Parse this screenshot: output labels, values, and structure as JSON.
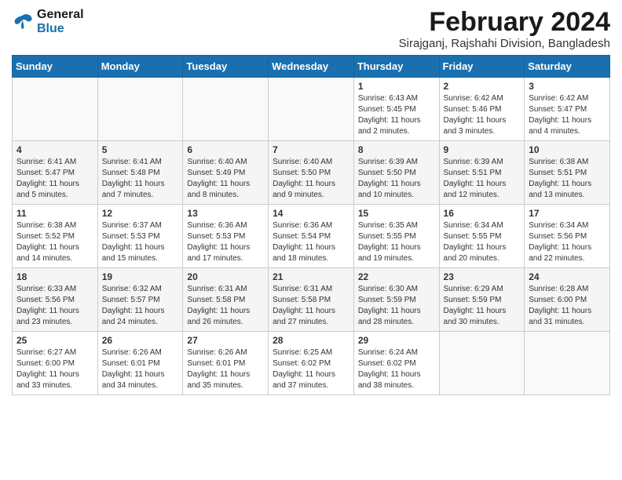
{
  "header": {
    "logo_line1": "General",
    "logo_line2": "Blue",
    "month_year": "February 2024",
    "location": "Sirajganj, Rajshahi Division, Bangladesh"
  },
  "days_of_week": [
    "Sunday",
    "Monday",
    "Tuesday",
    "Wednesday",
    "Thursday",
    "Friday",
    "Saturday"
  ],
  "weeks": [
    [
      {
        "day": "",
        "info": ""
      },
      {
        "day": "",
        "info": ""
      },
      {
        "day": "",
        "info": ""
      },
      {
        "day": "",
        "info": ""
      },
      {
        "day": "1",
        "info": "Sunrise: 6:43 AM\nSunset: 5:45 PM\nDaylight: 11 hours\nand 2 minutes."
      },
      {
        "day": "2",
        "info": "Sunrise: 6:42 AM\nSunset: 5:46 PM\nDaylight: 11 hours\nand 3 minutes."
      },
      {
        "day": "3",
        "info": "Sunrise: 6:42 AM\nSunset: 5:47 PM\nDaylight: 11 hours\nand 4 minutes."
      }
    ],
    [
      {
        "day": "4",
        "info": "Sunrise: 6:41 AM\nSunset: 5:47 PM\nDaylight: 11 hours\nand 5 minutes."
      },
      {
        "day": "5",
        "info": "Sunrise: 6:41 AM\nSunset: 5:48 PM\nDaylight: 11 hours\nand 7 minutes."
      },
      {
        "day": "6",
        "info": "Sunrise: 6:40 AM\nSunset: 5:49 PM\nDaylight: 11 hours\nand 8 minutes."
      },
      {
        "day": "7",
        "info": "Sunrise: 6:40 AM\nSunset: 5:50 PM\nDaylight: 11 hours\nand 9 minutes."
      },
      {
        "day": "8",
        "info": "Sunrise: 6:39 AM\nSunset: 5:50 PM\nDaylight: 11 hours\nand 10 minutes."
      },
      {
        "day": "9",
        "info": "Sunrise: 6:39 AM\nSunset: 5:51 PM\nDaylight: 11 hours\nand 12 minutes."
      },
      {
        "day": "10",
        "info": "Sunrise: 6:38 AM\nSunset: 5:51 PM\nDaylight: 11 hours\nand 13 minutes."
      }
    ],
    [
      {
        "day": "11",
        "info": "Sunrise: 6:38 AM\nSunset: 5:52 PM\nDaylight: 11 hours\nand 14 minutes."
      },
      {
        "day": "12",
        "info": "Sunrise: 6:37 AM\nSunset: 5:53 PM\nDaylight: 11 hours\nand 15 minutes."
      },
      {
        "day": "13",
        "info": "Sunrise: 6:36 AM\nSunset: 5:53 PM\nDaylight: 11 hours\nand 17 minutes."
      },
      {
        "day": "14",
        "info": "Sunrise: 6:36 AM\nSunset: 5:54 PM\nDaylight: 11 hours\nand 18 minutes."
      },
      {
        "day": "15",
        "info": "Sunrise: 6:35 AM\nSunset: 5:55 PM\nDaylight: 11 hours\nand 19 minutes."
      },
      {
        "day": "16",
        "info": "Sunrise: 6:34 AM\nSunset: 5:55 PM\nDaylight: 11 hours\nand 20 minutes."
      },
      {
        "day": "17",
        "info": "Sunrise: 6:34 AM\nSunset: 5:56 PM\nDaylight: 11 hours\nand 22 minutes."
      }
    ],
    [
      {
        "day": "18",
        "info": "Sunrise: 6:33 AM\nSunset: 5:56 PM\nDaylight: 11 hours\nand 23 minutes."
      },
      {
        "day": "19",
        "info": "Sunrise: 6:32 AM\nSunset: 5:57 PM\nDaylight: 11 hours\nand 24 minutes."
      },
      {
        "day": "20",
        "info": "Sunrise: 6:31 AM\nSunset: 5:58 PM\nDaylight: 11 hours\nand 26 minutes."
      },
      {
        "day": "21",
        "info": "Sunrise: 6:31 AM\nSunset: 5:58 PM\nDaylight: 11 hours\nand 27 minutes."
      },
      {
        "day": "22",
        "info": "Sunrise: 6:30 AM\nSunset: 5:59 PM\nDaylight: 11 hours\nand 28 minutes."
      },
      {
        "day": "23",
        "info": "Sunrise: 6:29 AM\nSunset: 5:59 PM\nDaylight: 11 hours\nand 30 minutes."
      },
      {
        "day": "24",
        "info": "Sunrise: 6:28 AM\nSunset: 6:00 PM\nDaylight: 11 hours\nand 31 minutes."
      }
    ],
    [
      {
        "day": "25",
        "info": "Sunrise: 6:27 AM\nSunset: 6:00 PM\nDaylight: 11 hours\nand 33 minutes."
      },
      {
        "day": "26",
        "info": "Sunrise: 6:26 AM\nSunset: 6:01 PM\nDaylight: 11 hours\nand 34 minutes."
      },
      {
        "day": "27",
        "info": "Sunrise: 6:26 AM\nSunset: 6:01 PM\nDaylight: 11 hours\nand 35 minutes."
      },
      {
        "day": "28",
        "info": "Sunrise: 6:25 AM\nSunset: 6:02 PM\nDaylight: 11 hours\nand 37 minutes."
      },
      {
        "day": "29",
        "info": "Sunrise: 6:24 AM\nSunset: 6:02 PM\nDaylight: 11 hours\nand 38 minutes."
      },
      {
        "day": "",
        "info": ""
      },
      {
        "day": "",
        "info": ""
      }
    ]
  ]
}
